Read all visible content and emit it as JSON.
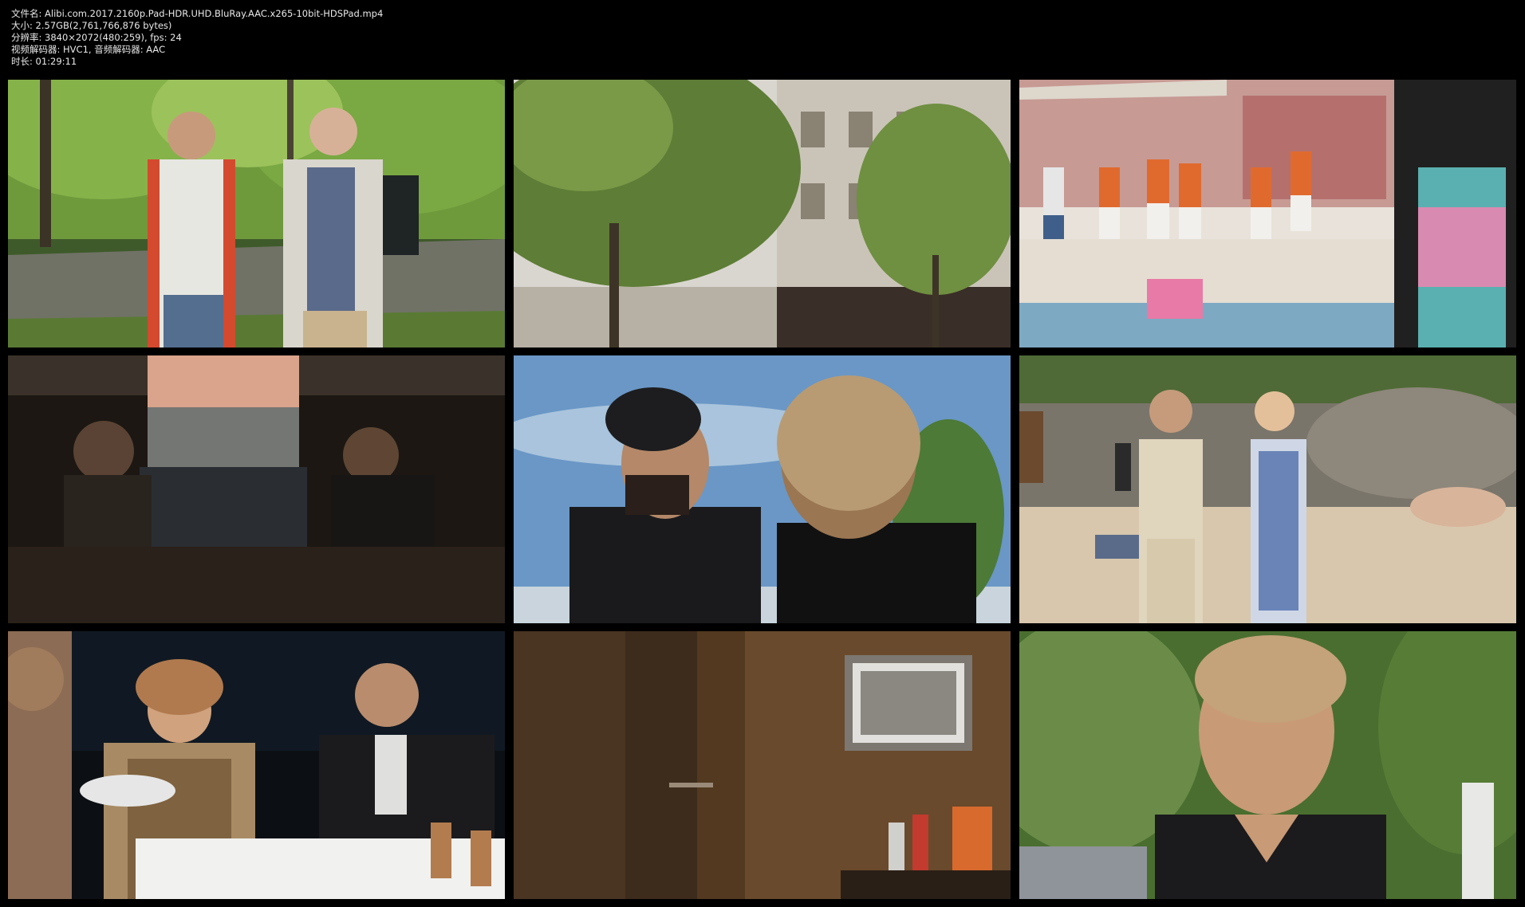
{
  "file_info": {
    "filename": "文件名: Alibi.com.2017.2160p.Pad-HDR.UHD.BluRay.AAC.x265-10bit-HDSPad.mp4",
    "size": "大小: 2.57GB(2,761,766,876 bytes)",
    "resolution": "分辨率: 3840×2072(480:259), fps: 24",
    "codecs": "视频解码器: HVC1, 音频解码器: AAC",
    "duration": "时长: 01:29:11"
  },
  "thumbnails": [
    {
      "scene": "forest-road-two-men"
    },
    {
      "scene": "paris-building-trees"
    },
    {
      "scene": "pool-party"
    },
    {
      "scene": "under-bed-men"
    },
    {
      "scene": "man-in-cap-outdoors"
    },
    {
      "scene": "beach-couple"
    },
    {
      "scene": "dinner-table"
    },
    {
      "scene": "wooden-room-picture"
    },
    {
      "scene": "blond-man-closeup"
    }
  ],
  "colors": {
    "background": "#000000",
    "text": "#e8e8e8"
  }
}
